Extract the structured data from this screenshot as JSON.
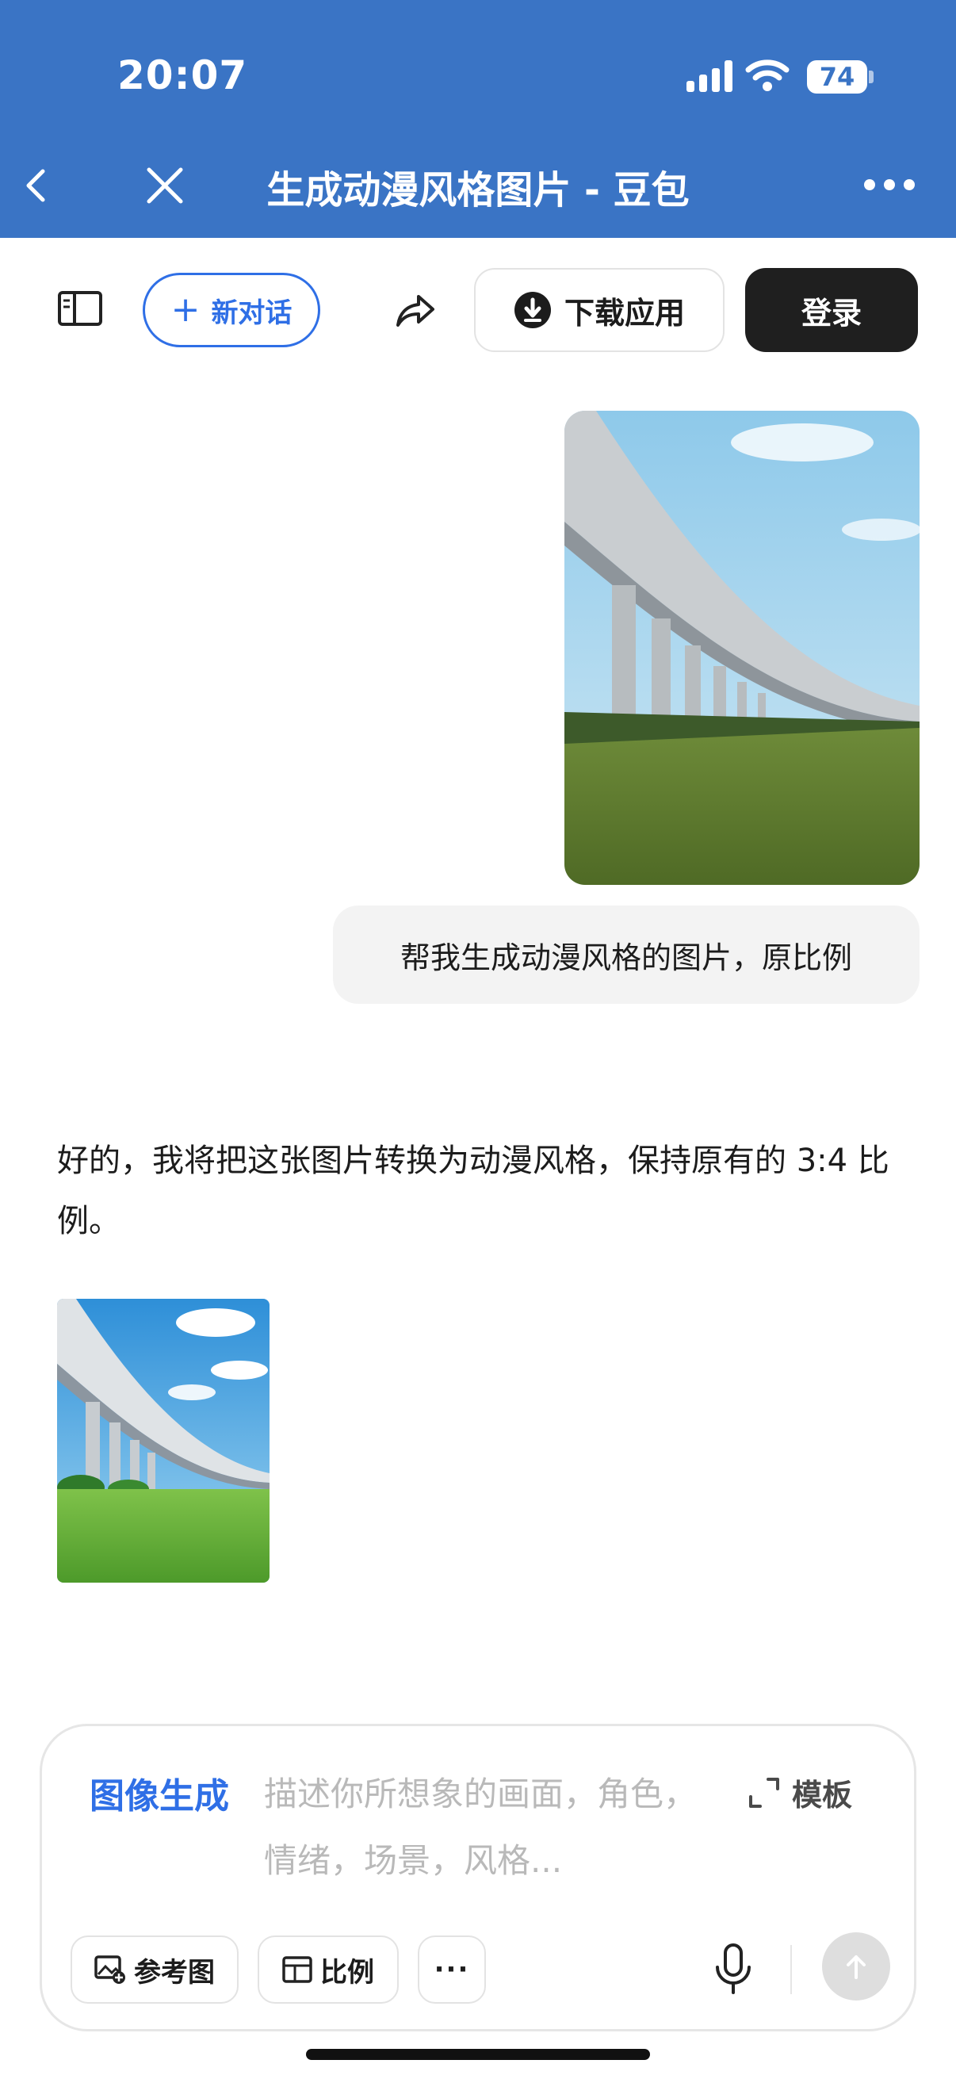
{
  "status_bar": {
    "time": "20:07",
    "battery": "74"
  },
  "nav": {
    "title": "生成动漫风格图片 - 豆包"
  },
  "toolbar": {
    "new_chat_label": "新对话",
    "download_label": "下载应用",
    "login_label": "登录"
  },
  "chat": {
    "user_message": "帮我生成动漫风格的图片，原比例",
    "bot_message": "好的，我将把这张图片转换为动漫风格，保持原有的 3:4 比例。"
  },
  "composer": {
    "mode_label": "图像生成",
    "placeholder": "描述你所想象的画面，角色，情绪，场景，风格...",
    "template_label": "模板",
    "reference_label": "参考图",
    "ratio_label": "比例",
    "more_label": "···"
  },
  "colors": {
    "brand_blue": "#3a74c5",
    "accent_blue": "#2f6fe6",
    "login_bg": "#1f1f1f"
  }
}
